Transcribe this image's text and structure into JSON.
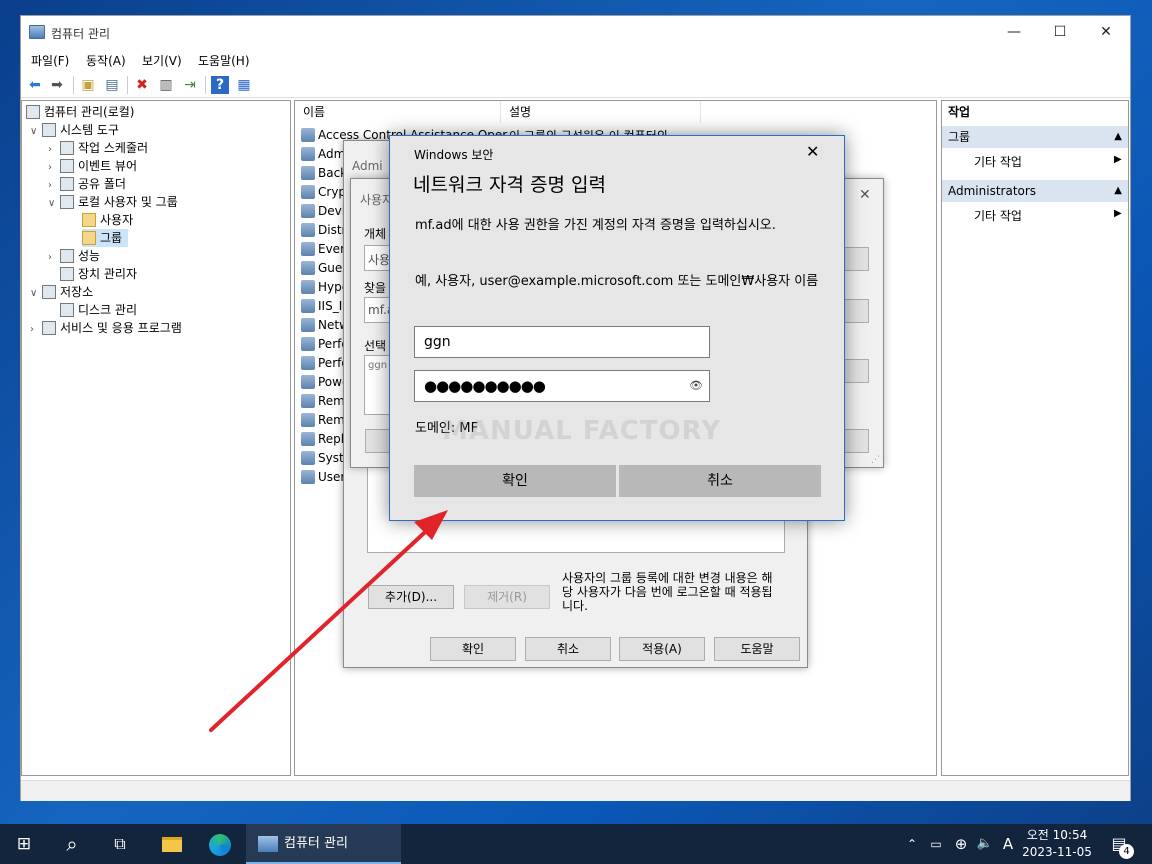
{
  "window": {
    "title": "컴퓨터 관리",
    "controls": {
      "minimize": "—",
      "maximize": "☐",
      "close": "✕"
    }
  },
  "menu": [
    "파일(F)",
    "동작(A)",
    "보기(V)",
    "도움말(H)"
  ],
  "tree": {
    "root": "컴퓨터 관리(로컬)",
    "system_tools": "시스템 도구",
    "task_scheduler": "작업 스케줄러",
    "event_viewer": "이벤트 뷰어",
    "shared_folders": "공유 폴더",
    "local_users_groups": "로컬 사용자 및 그룹",
    "users": "사용자",
    "groups": "그룹",
    "performance": "성능",
    "device_manager": "장치 관리자",
    "storage": "저장소",
    "disk_management": "디스크 관리",
    "services_apps": "서비스 및 응용 프로그램"
  },
  "list": {
    "col_name": "이름",
    "col_desc": "설명",
    "rows": [
      "Access Control Assistance Oper",
      "Admi",
      "Back",
      "Cryp",
      "Devi",
      "Distr",
      "Even",
      "Gues",
      "Hype",
      "IIS_IU",
      "Netw",
      "Perfo",
      "Perfo",
      "Powe",
      "Remo",
      "Remo",
      "Repli",
      "Syste",
      "Users"
    ],
    "first_desc": "이 그룹의 구성원은 이 컴퓨터의"
  },
  "actions": {
    "header": "작업",
    "group1": "그룹",
    "more1": "기타 작업",
    "group2": "Administrators",
    "more2": "기타 작업"
  },
  "props_dialog": {
    "title": "Admi",
    "note": "사용자의 그룹 등록에 대한 변경 내용은 해당 사용자가 다음 번에 로그온할 때 적용됩니다.",
    "add": "추가(D)...",
    "remove": "제거(R)",
    "ok": "확인",
    "cancel": "취소",
    "apply": "적용(A)",
    "help": "도움말"
  },
  "select_dialog": {
    "title": "사용자",
    "obj_label": "개체",
    "obj_value": "사용",
    "loc_label": "찾을",
    "loc_value": "mf.a",
    "enter_label": "선택",
    "enter_value": "ggn"
  },
  "cred_dialog": {
    "header": "Windows 보안",
    "title": "네트워크 자격 증명 입력",
    "message": "mf.ad에 대한 사용 권한을 가진 계정의 자격 증명을 입력하십시오.",
    "example": "예, 사용자, user@example.microsoft.com  또는  도메인₩사용자 이름",
    "username": "ggn",
    "password_mask": "●●●●●●●●●●",
    "domain": "도메인: MF",
    "watermark": "MANUAL FACTORY",
    "ok": "확인",
    "cancel": "취소",
    "close": "✕"
  },
  "taskbar": {
    "app_label": "컴퓨터 관리",
    "ime": "A",
    "time": "오전 10:54",
    "date": "2023-11-05",
    "notification_count": "4"
  },
  "colors": {
    "accent": "#2b6cc4",
    "arrow": "#e0242a",
    "taskbar": "#13243d"
  }
}
